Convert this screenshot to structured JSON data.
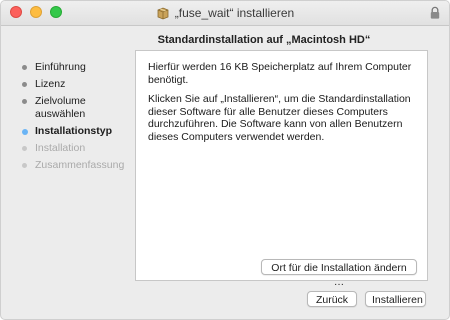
{
  "window": {
    "title": "„fuse_wait“ installieren",
    "icons": {
      "package": "package-icon",
      "lock": "lock-icon"
    }
  },
  "header": {
    "label": "Standardinstallation auf „Macintosh HD“"
  },
  "sidebar": {
    "steps": [
      {
        "label": "Einführung",
        "state": "done"
      },
      {
        "label": "Lizenz",
        "state": "done"
      },
      {
        "label": "Zielvolume",
        "label2": "auswählen",
        "state": "done"
      },
      {
        "label": "Installationstyp",
        "state": "current"
      },
      {
        "label": "Installation",
        "state": "pending"
      },
      {
        "label": "Zusammenfassung",
        "state": "pending"
      }
    ]
  },
  "content": {
    "paragraph1": "Hierfür werden 16 KB Speicherplatz auf Ihrem Computer benötigt.",
    "paragraph2": "Klicken Sie auf „Installieren“, um die Standardinstallation dieser Software für alle Benutzer dieses Computers durchzuführen. Die Software kann von allen Benutzern dieses Computers verwendet werden.",
    "change_location_label": "Ort für die Installation ändern …"
  },
  "footer": {
    "back_label": "Zurück",
    "install_label": "Installieren"
  },
  "colors": {
    "window_bg": "#ececec",
    "panel_bg": "#ffffff",
    "current_step_dot": "#6ab4f5",
    "close": "#fc605c",
    "minimize": "#fdbc40",
    "maximize": "#34c84a"
  }
}
